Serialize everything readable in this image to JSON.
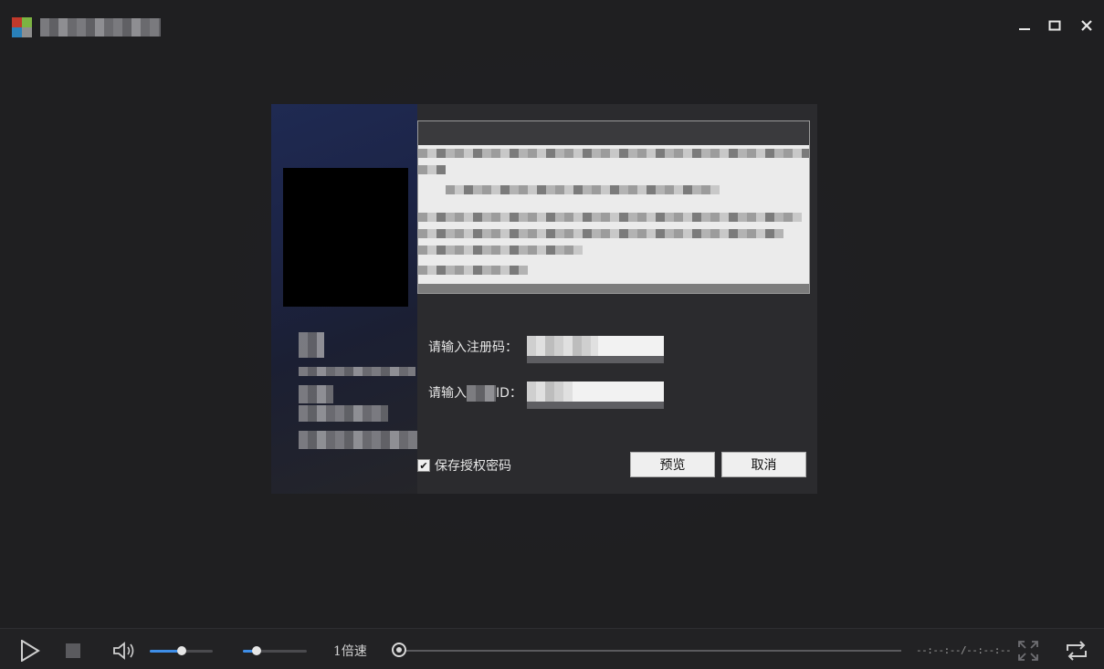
{
  "window": {
    "title": "",
    "controls": {
      "minimize_icon": "minimize-icon",
      "maximize_icon": "maximize-icon",
      "close_icon": "close-icon"
    }
  },
  "dialog": {
    "labels": {
      "registration_code": "请输入注册码：",
      "id_prefix": "请输入",
      "id_suffix": "ID："
    },
    "save_password_label": "保存授权密码",
    "save_password_checked": true,
    "preview_button": "预览",
    "cancel_button": "取消"
  },
  "player": {
    "speed_label": "1倍速",
    "time_display": "--:--:--/--:--:--",
    "volume_level": 0.5,
    "volume_icon": "speaker-icon",
    "secondary_slider_level": 0.2,
    "progress_level": 0.0,
    "play_icon": "play-icon",
    "stop_icon": "stop-icon",
    "fullscreen_icon": "fullscreen-icon",
    "repeat_icon": "repeat-icon"
  },
  "colors": {
    "background": "#1f1f21",
    "accent": "#3e8ee8",
    "dialog_bg": "#2b2b2e"
  }
}
